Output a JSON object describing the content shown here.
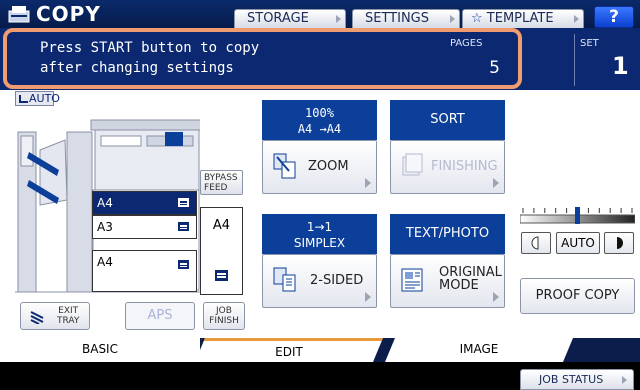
{
  "header": {
    "title": "COPY",
    "storage_label": "STORAGE",
    "settings_label": "SETTINGS",
    "template_label": "TEMPLATE",
    "help_label": "?"
  },
  "message": {
    "line1": "Press START button to copy",
    "line2": "after changing settings",
    "pages_label": "PAGES",
    "pages_value": "5",
    "set_label": "SET",
    "set_value": "1"
  },
  "paper": {
    "auto_label": "AUTO",
    "trays": [
      "A4",
      "A3",
      "A4"
    ],
    "bypass_label_line1": "BYPASS",
    "bypass_label_line2": "FEED",
    "bypass_size": "A4",
    "exit_tray_line1": "EXIT",
    "exit_tray_line2": "TRAY",
    "aps_label": "APS",
    "job_finish_line1": "JOB",
    "job_finish_line2": "FINISH"
  },
  "zoom": {
    "percent": "100%",
    "sizes": "A4 →A4",
    "button_label": "ZOOM"
  },
  "finishing": {
    "mode": "SORT",
    "button_label": "FINISHING"
  },
  "duplex": {
    "line1": "1→1",
    "line2": "SIMPLEX",
    "button_label": "2-SIDED"
  },
  "original_mode": {
    "mode": "TEXT/PHOTO",
    "button_line1": "ORIGINAL",
    "button_line2": "MODE"
  },
  "density": {
    "auto_label": "AUTO",
    "level_fraction": 0.5
  },
  "proof_copy_label": "PROOF COPY",
  "tabs": [
    "BASIC",
    "EDIT",
    "IMAGE"
  ],
  "job_status_label": "JOB STATUS",
  "colors": {
    "header_blue": "#0b2a6b",
    "highlight": "#ee9c70",
    "function_blue": "#0b3f9a",
    "edit_tab_accent": "#e89a3a"
  }
}
